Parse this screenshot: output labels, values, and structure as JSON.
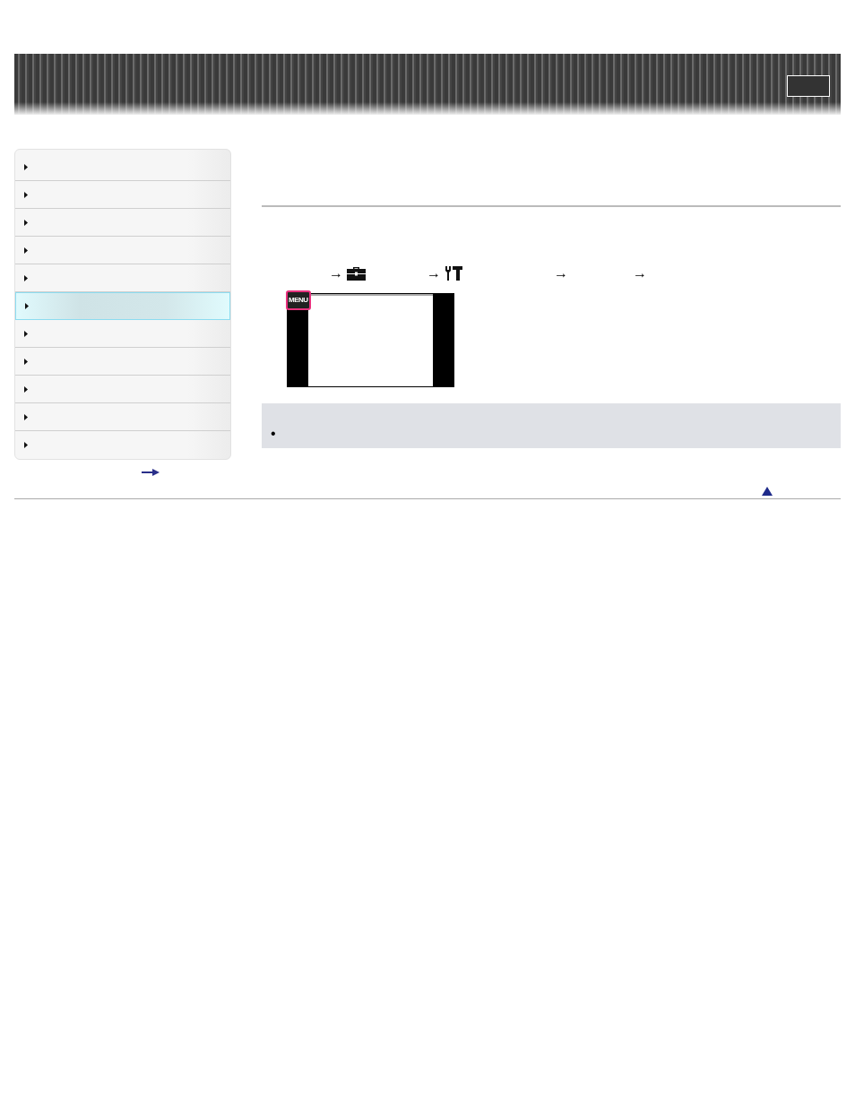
{
  "nav": [
    {
      "selected": false
    },
    {
      "selected": false
    },
    {
      "selected": false
    },
    {
      "selected": false
    },
    {
      "selected": false
    },
    {
      "selected": true
    },
    {
      "selected": false
    },
    {
      "selected": false
    },
    {
      "selected": false
    },
    {
      "selected": false
    },
    {
      "selected": false
    }
  ],
  "steps": {
    "arrows": [
      "→",
      "→",
      "→",
      "→"
    ]
  },
  "screen": {
    "menu_key": "MENU"
  },
  "note": {
    "bullet": "•"
  }
}
